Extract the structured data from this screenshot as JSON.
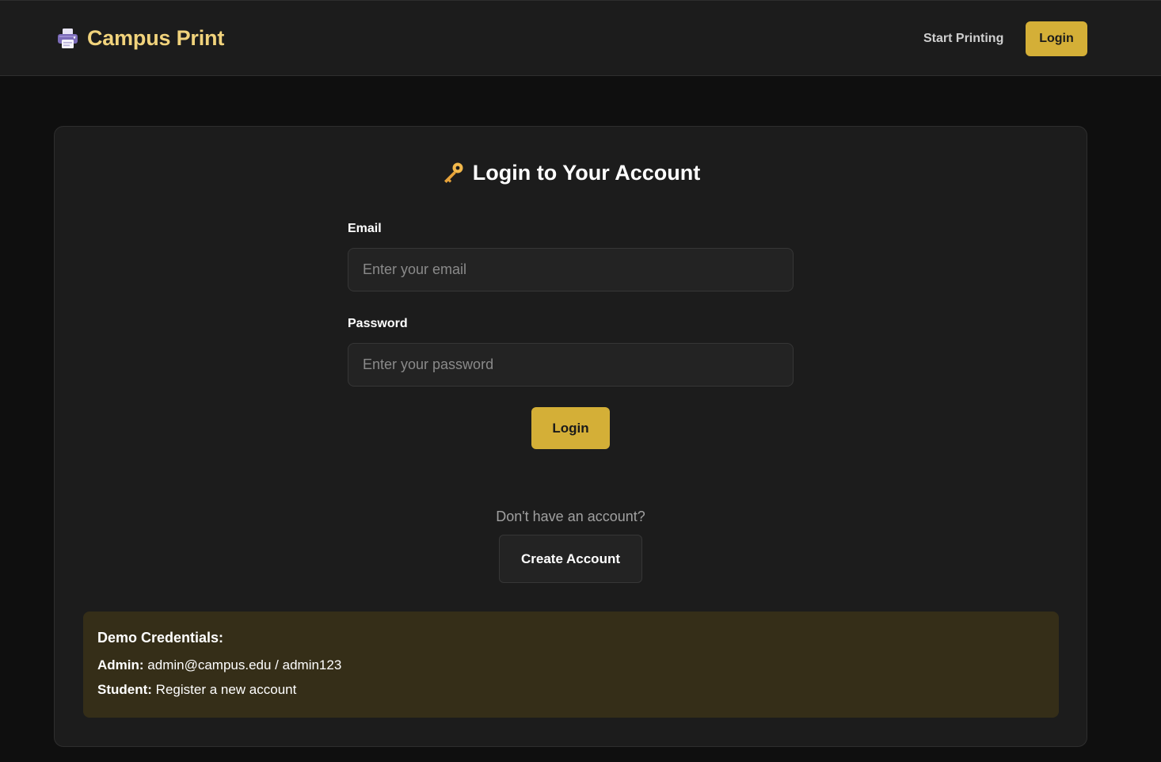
{
  "header": {
    "brand_name": "Campus Print",
    "brand_icon": "printer-icon",
    "nav_link": "Start Printing",
    "nav_login": "Login",
    "accent_color": "#d4af37"
  },
  "login_card": {
    "title": "Login to Your Account",
    "title_icon": "key-icon",
    "email_label": "Email",
    "email_placeholder": "Enter your email",
    "email_value": "",
    "password_label": "Password",
    "password_placeholder": "Enter your password",
    "password_value": "",
    "submit_label": "Login",
    "no_account_text": "Don't have an account?",
    "create_account_label": "Create Account"
  },
  "demo": {
    "title": "Demo Credentials:",
    "admin_key": "Admin:",
    "admin_value": "admin@campus.edu / admin123",
    "student_key": "Student:",
    "student_value": "Register a new account",
    "background_color": "#352e18"
  }
}
